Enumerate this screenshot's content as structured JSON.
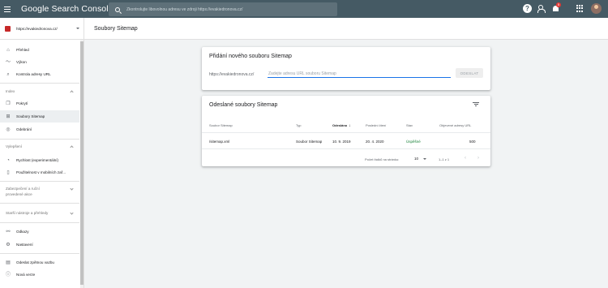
{
  "app": {
    "brand_google": "Google",
    "brand_product": "Search Console"
  },
  "search": {
    "placeholder": "Zkontrolujte libovolnou adresu ve zdroji https://evakiedronova.cz/"
  },
  "topbar": {
    "notifications_count": "5"
  },
  "sidebar": {
    "property": "https://evakiedronova.cz/",
    "items": [
      {
        "label": "Přehled",
        "icon": "home-icon"
      },
      {
        "label": "Výkon",
        "icon": "trend-icon"
      },
      {
        "label": "Kontrola adresy URL",
        "icon": "search-icon"
      }
    ],
    "section_index": "Index",
    "index_items": [
      {
        "label": "Pokrytí",
        "icon": "file-copy-icon"
      },
      {
        "label": "Soubory Sitemap",
        "icon": "sitemap-icon",
        "active": true
      },
      {
        "label": "Odebrání",
        "icon": "eye-off-icon"
      }
    ],
    "section_enhancements": "Vylepšení",
    "enh_items": [
      {
        "label": "Rychlost (experimentální)",
        "icon": "speed-icon"
      },
      {
        "label": "Použitelnost v mobilních zař...",
        "icon": "phone-icon"
      }
    ],
    "section_security_line1": "Zabezpečení a ruční",
    "section_security_line2": "provedené akce",
    "section_legacy": "Starší nástroje a přehledy",
    "bottom_items": [
      {
        "label": "Odkazy",
        "icon": "links-icon"
      },
      {
        "label": "Nastavení",
        "icon": "settings-icon"
      },
      {
        "label": "Odeslat zpětnou vazbu",
        "icon": "feedback-icon"
      },
      {
        "label": "Nová verze",
        "icon": "info-icon"
      }
    ]
  },
  "page": {
    "title": "Soubory Sitemap"
  },
  "add_sitemap": {
    "title": "Přidání nového souboru Sitemap",
    "url_prefix": "https://evakiedronova.cz/",
    "input_placeholder": "Zadejte adresu URL souboru Sitemap",
    "submit_label": "ODESLAT"
  },
  "submitted": {
    "title": "Odeslané soubory Sitemap",
    "columns": [
      "Soubor Sitemap",
      "Typ",
      "Odesláno",
      "Poslední čtení",
      "Stav",
      "Objevené adresy URL"
    ],
    "rows": [
      [
        "/sitemap.xml",
        "Soubor Sitemap",
        "10. 9. 2019",
        "20. 4. 2020",
        "Úspěšné",
        "500"
      ]
    ],
    "pager_label": "Počet řádků na stránku:",
    "rows_per_page": "10",
    "range": "1–1 z 1"
  },
  "colors": {
    "topbar": "#455a64",
    "accent": "#1a73e8",
    "success": "#188038",
    "property_icon": "#c62828"
  }
}
